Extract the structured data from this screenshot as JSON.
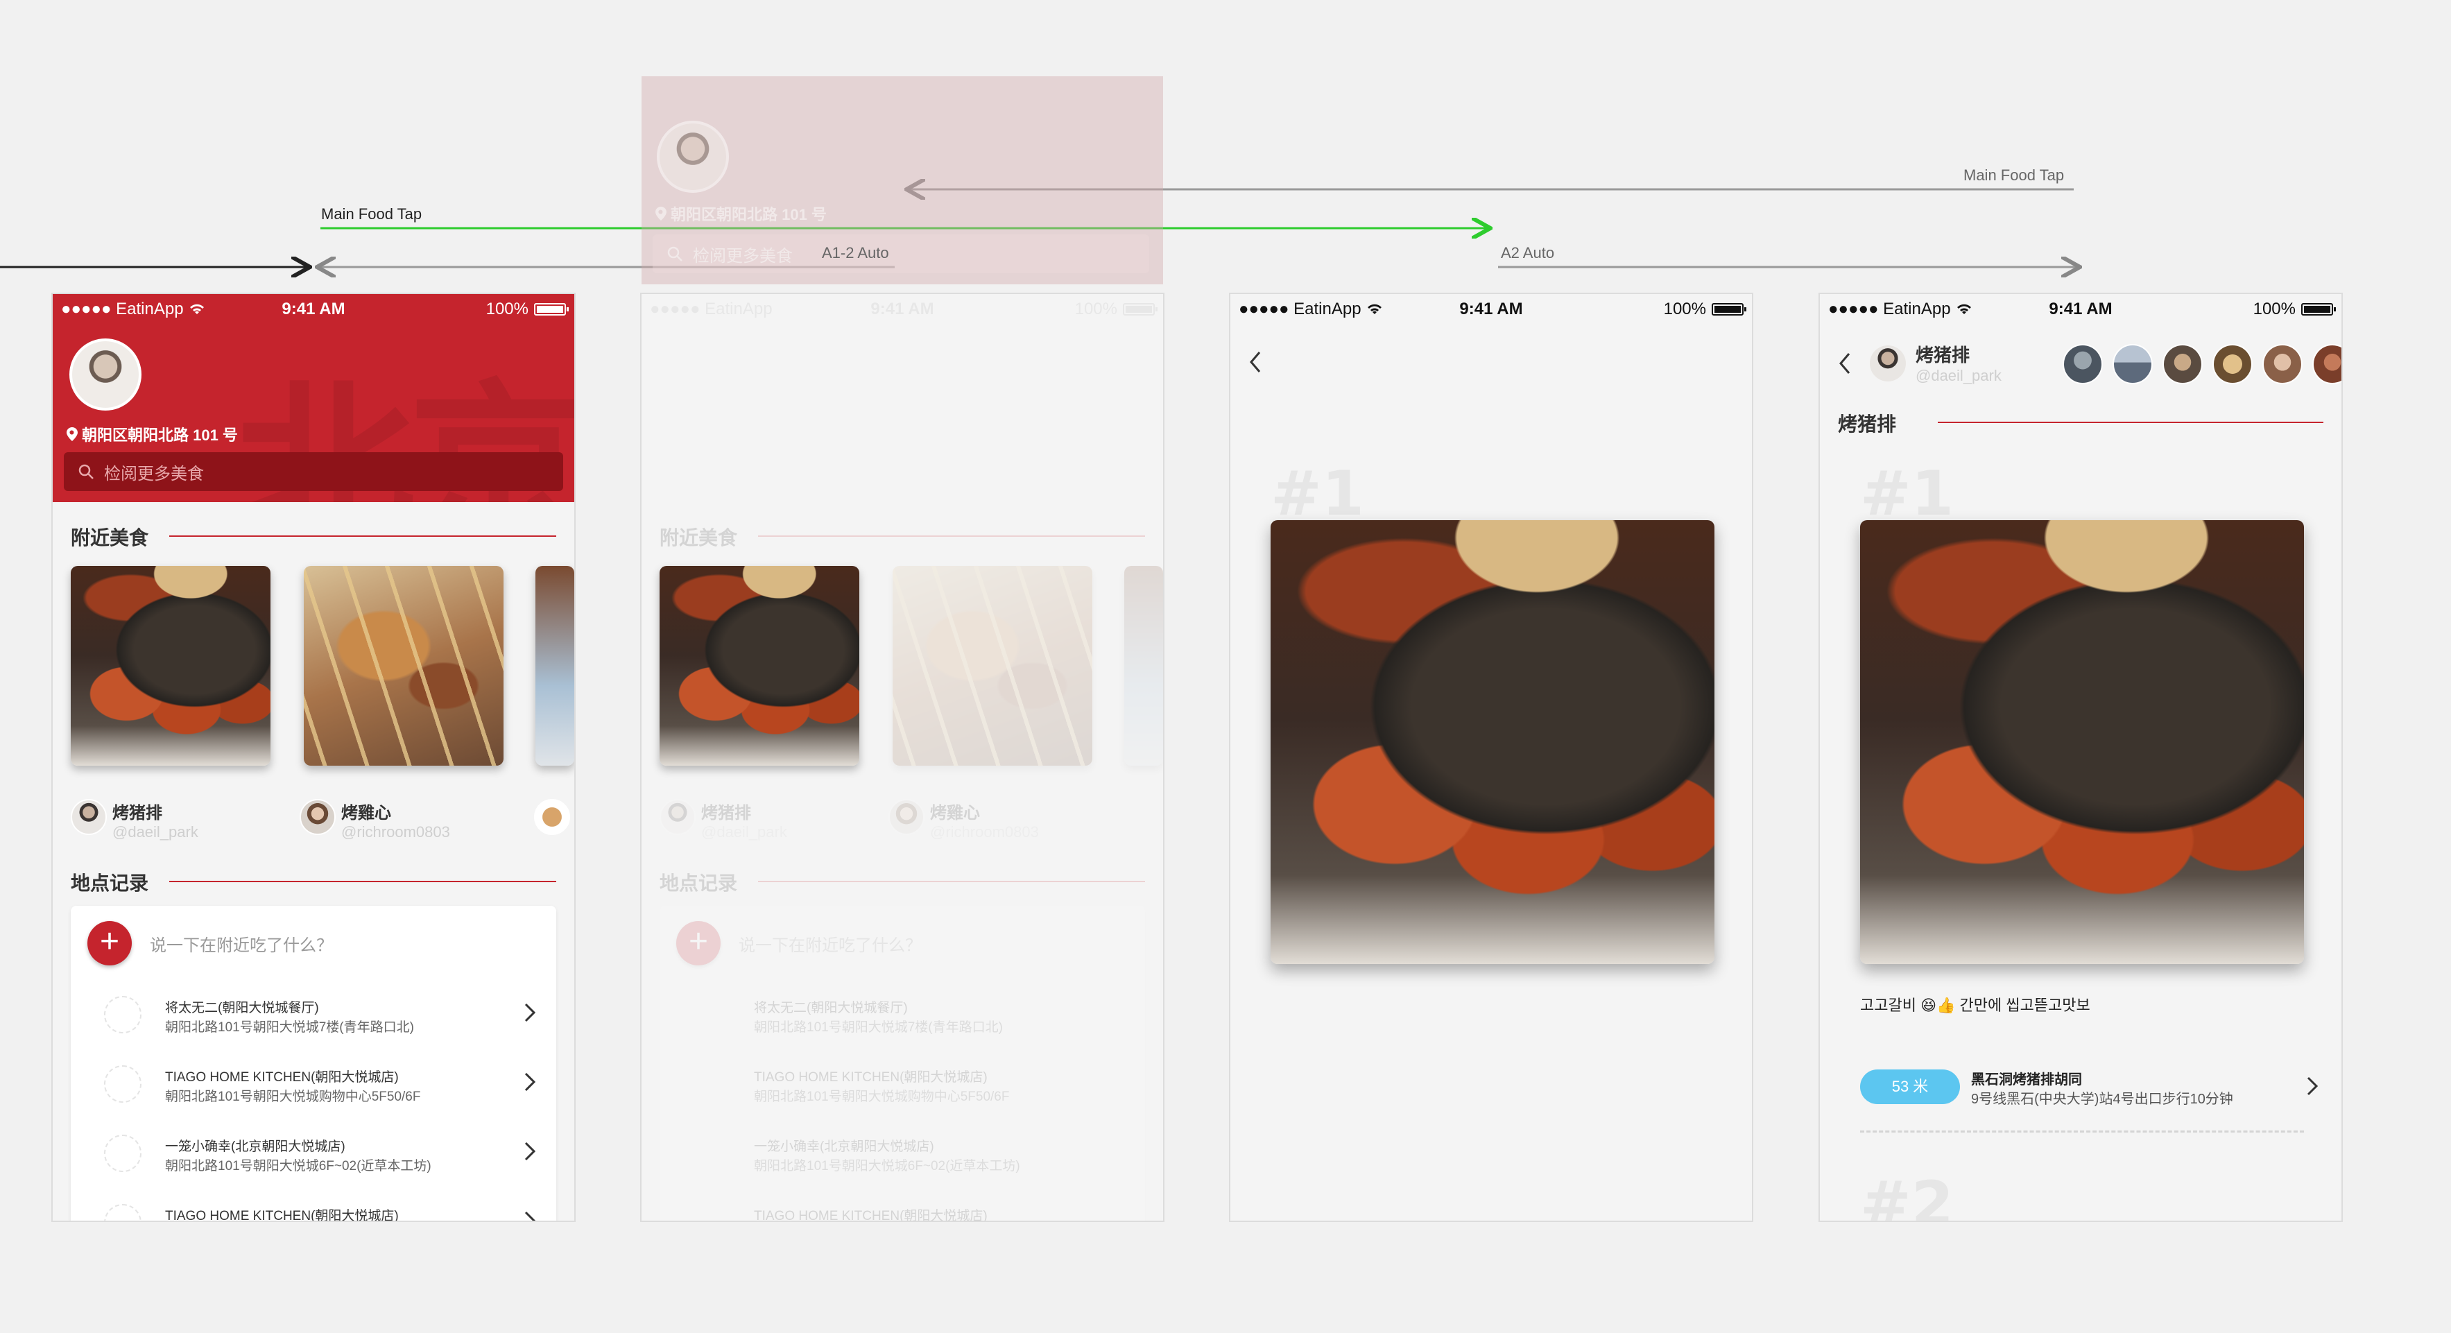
{
  "flow": {
    "label_main_tap_1": "Main Food Tap",
    "label_main_tap_2": "Main Food Tap",
    "label_a1": "A1-2 Auto",
    "label_a2": "A2 Auto"
  },
  "status": {
    "carrier": "●●●●● EatinApp",
    "time": "9:41 AM",
    "battery": "100%"
  },
  "home": {
    "bg_chars": "北京",
    "address": "朝阳区朝阳北路 101 号",
    "search_placeholder": "检阅更多美食",
    "nearby_title": "附近美食",
    "foods": [
      {
        "name": "烤猪排",
        "handle": "@daeil_park"
      },
      {
        "name": "烤雞心",
        "handle": "@richroom0803"
      }
    ],
    "records_title": "地点记录",
    "record_prompt": "说一下在附近吃了什么？",
    "record_plus": "+",
    "places": [
      {
        "name": "将太无二(朝阳大悦城餐厅)",
        "addr": "朝阳北路101号朝阳大悦城7楼(青年路口北)"
      },
      {
        "name": "TIAGO HOME KITCHEN(朝阳大悦城店)",
        "addr": "朝阳北路101号朝阳大悦城购物中心5F50/6F"
      },
      {
        "name": "一笼小确幸(北京朝阳大悦城店)",
        "addr": "朝阳北路101号朝阳大悦城6F~02(近草本工坊)"
      },
      {
        "name": "TIAGO HOME KITCHEN(朝阳大悦城店)",
        "addr": ""
      }
    ]
  },
  "detail": {
    "rank1": "#1",
    "rank2": "#2",
    "user_name": "烤猪排",
    "user_handle": "@daeil_park",
    "dish_title": "烤猪排",
    "caption": "고고갈비 😆👍 간만에 씹고뜯고맛보",
    "distance": "53 米",
    "dist_name": "黑石洞烤猪排胡同",
    "dist_addr": "9号线黑石(中央大学)站4号出口步行10分钟"
  },
  "colors": {
    "brand_red": "#c5242d",
    "flow_green": "#2ecc2e",
    "badge_blue": "#5cc6f0"
  }
}
